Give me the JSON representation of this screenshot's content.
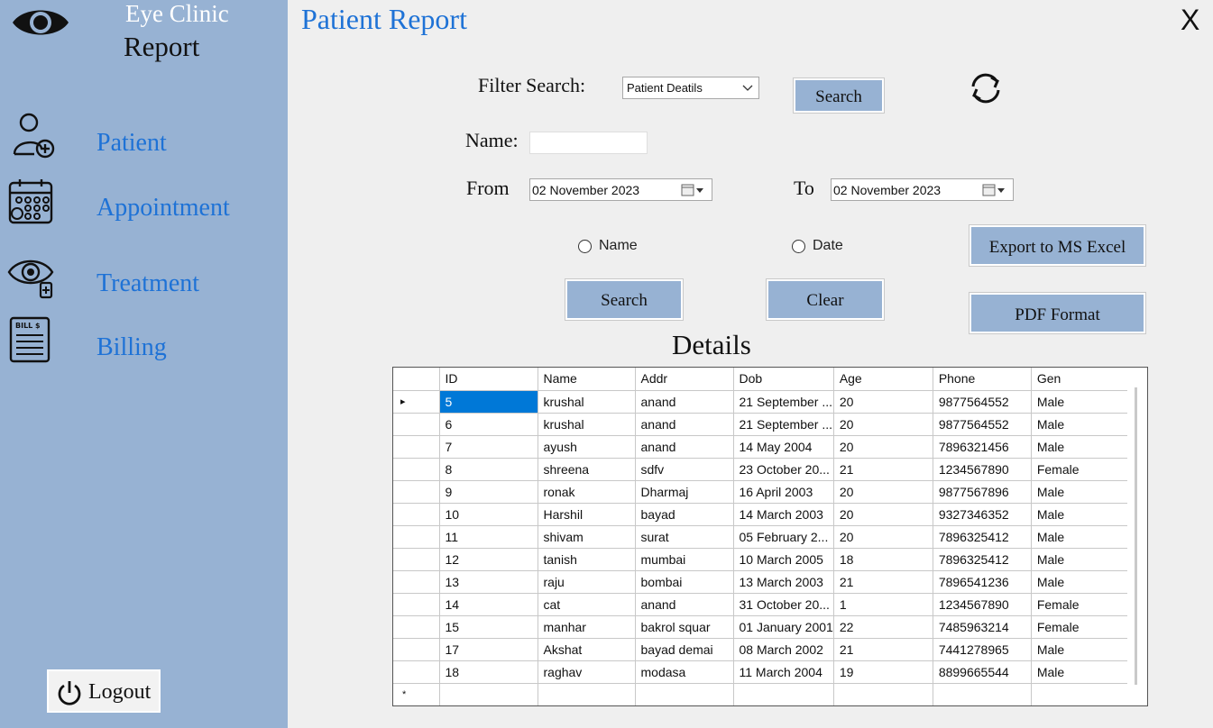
{
  "app": {
    "name": "Eye Clinic",
    "section": "Report",
    "page_title": "Patient Report",
    "close_label": "X"
  },
  "sidebar": {
    "items": [
      {
        "label": "Patient",
        "icon": "patient-icon"
      },
      {
        "label": "Appointment",
        "icon": "calendar-icon"
      },
      {
        "label": "Treatment",
        "icon": "eye-treatment-icon"
      },
      {
        "label": "Billing",
        "icon": "bill-icon"
      }
    ],
    "logout_label": "Logout",
    "bill_icon_text": "BILL $"
  },
  "filters": {
    "filter_label": "Filter Search:",
    "filter_value": "Patient Deatils",
    "search_top_label": "Search",
    "name_label": "Name:",
    "name_value": "",
    "from_label": "From",
    "from_value": "02 November 2023",
    "to_label": "To",
    "to_value": "02 November 2023",
    "radio_name_label": "Name",
    "radio_date_label": "Date",
    "search_label": "Search",
    "clear_label": "Clear",
    "export_label": "Export to MS Excel",
    "pdf_label": "PDF Format"
  },
  "details": {
    "title": "Details",
    "columns": [
      "ID",
      "Name",
      "Addr",
      "Dob",
      "Age",
      "Phone",
      "Gen"
    ],
    "rows": [
      [
        "5",
        "krushal",
        "anand",
        "21 September ...",
        "20",
        "9877564552",
        "Male"
      ],
      [
        "6",
        "krushal",
        "anand",
        "21 September ...",
        "20",
        "9877564552",
        "Male"
      ],
      [
        "7",
        "ayush",
        "anand",
        "14 May 2004",
        "20",
        "7896321456",
        "Male"
      ],
      [
        "8",
        "shreena",
        "sdfv",
        "23 October 20...",
        "21",
        "1234567890",
        "Female"
      ],
      [
        "9",
        "ronak",
        "Dharmaj",
        "16 April 2003",
        "20",
        "9877567896",
        "Male"
      ],
      [
        "10",
        "Harshil",
        "bayad",
        "14 March 2003",
        "20",
        "9327346352",
        "Male"
      ],
      [
        "11",
        "shivam",
        "surat",
        "05 February 2...",
        "20",
        "7896325412",
        "Male"
      ],
      [
        "12",
        "tanish",
        "mumbai",
        "10 March 2005",
        "18",
        "7896325412",
        "Male"
      ],
      [
        "13",
        "raju",
        "bombai",
        "13 March 2003",
        "21",
        "7896541236",
        "Male"
      ],
      [
        "14",
        "cat",
        "anand",
        "31 October 20...",
        "1",
        "1234567890",
        "Female"
      ],
      [
        "15",
        "manhar",
        "bakrol squar",
        "01 January 2001",
        "22",
        "7485963214",
        "Female"
      ],
      [
        "17",
        "Akshat",
        "bayad demai",
        "08 March 2002",
        "21",
        "7441278965",
        "Male"
      ],
      [
        "18",
        "raghav",
        "modasa",
        "11 March 2004",
        "19",
        "8899665544",
        "Male"
      ]
    ],
    "current_row_marker": "▸",
    "new_row_marker": "*"
  },
  "colors": {
    "sidebar": "#97b2d3",
    "accent": "#1e72d6",
    "selection": "#0078d7"
  }
}
